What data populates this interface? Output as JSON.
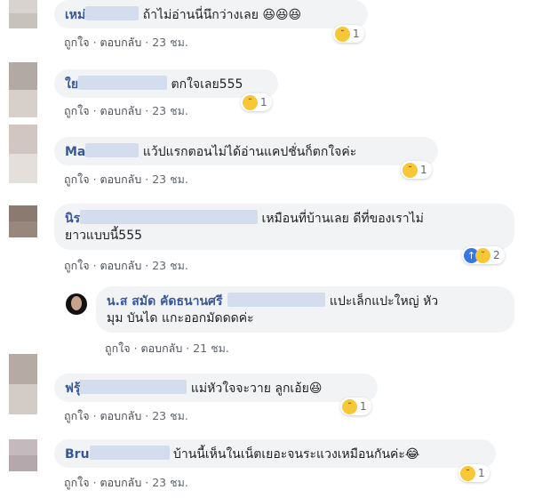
{
  "comments": [
    {
      "author": "เหม่",
      "text": "ถ้าไม่อ่านนี่นึกว่างเลย 😆😆😆",
      "like": "ถูกใจ",
      "reply": "ตอบกลับ",
      "time": "23 ชม.",
      "reaction_count": "1"
    },
    {
      "author": "ใย",
      "text": "ตกใจเลย555",
      "like": "ถูกใจ",
      "reply": "ตอบกลับ",
      "time": "23 ชม.",
      "reaction_count": "1"
    },
    {
      "author": "Ma",
      "text": "แว้ปแรกตอนไม่ได้อ่านแคปชั่นก็ตกใจค่ะ",
      "like": "ถูกใจ",
      "reply": "ตอบกลับ",
      "time": "23 ชม.",
      "reaction_count": "1"
    },
    {
      "author": "นิร",
      "text_line1": "เหมือนที่บ้านเลย ดีที่ของเราไม่",
      "text_line2": "ยาวแบบนี้555",
      "like": "ถูกใจ",
      "reply": "ตอบกลับ",
      "time": "23 ชม.",
      "reaction_count": "2"
    },
    {
      "author": "ฟรุ้",
      "text": "แม่หัวใจจะวาย ลูกเอ้ย😆",
      "like": "ถูกใจ",
      "reply": "ตอบกลับ",
      "time": "23 ชม.",
      "reaction_count": "1"
    },
    {
      "author": "Bru",
      "text": "บ้านนี้เห็นในเน็ตเยอะจนระแวงเหมือนกันค่ะ😂",
      "like": "ถูกใจ",
      "reply": "ตอบกลับ",
      "time": "23 ชม.",
      "reaction_count": "1"
    }
  ],
  "reply": {
    "author": "น.ส สมัด คัดธนานศรี",
    "text_line1": "แปะเล็กแปะใหญ่ หัว",
    "text_line2": "มุม บันได แกะออกมัดดดค่ะ",
    "like": "ถูกใจ",
    "reply": "ตอบกลับ",
    "time": "21 ชม."
  },
  "separator": "·",
  "colors": {
    "author": "#385898",
    "bubble": "#f2f3f5",
    "reaction": "#f7c736",
    "like": "#3578e5"
  }
}
